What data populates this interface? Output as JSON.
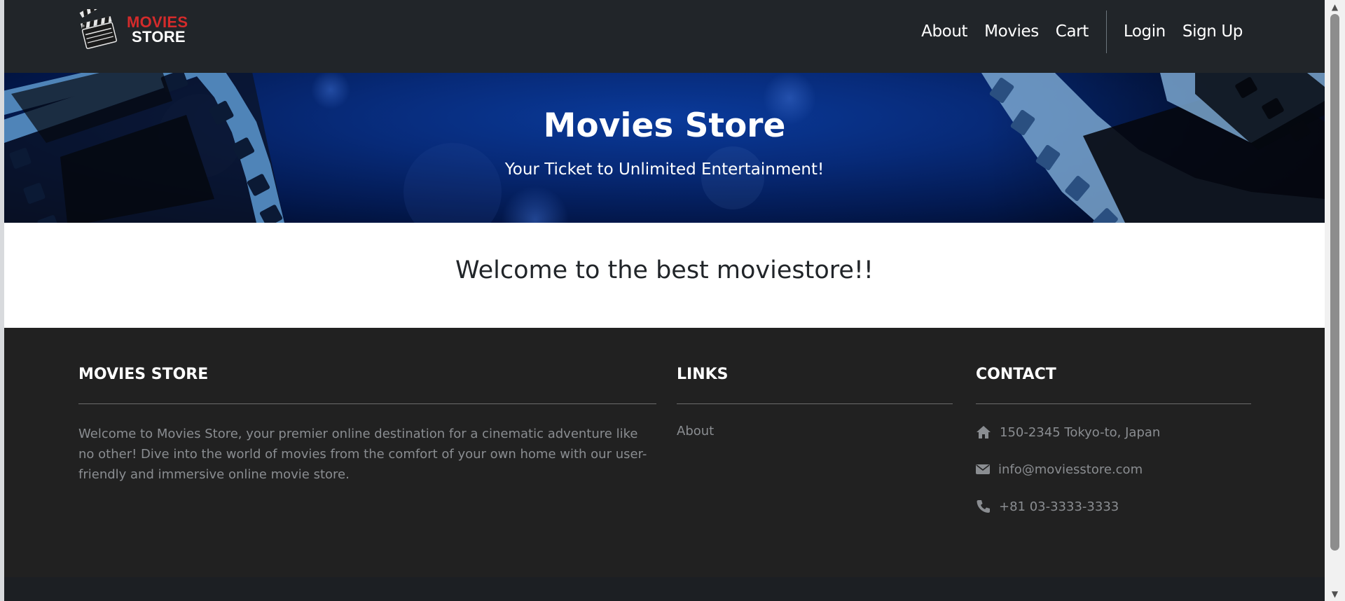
{
  "brand": {
    "logo_line1": "MOVIES",
    "logo_line2": "STORE",
    "logo_red": "#d42b2b"
  },
  "nav": {
    "about": "About",
    "movies": "Movies",
    "cart": "Cart",
    "login": "Login",
    "signup": "Sign Up"
  },
  "hero": {
    "title": "Movies Store",
    "subtitle": "Your Ticket to Unlimited Entertainment!",
    "background_color": "#072a78"
  },
  "welcome": {
    "heading": "Welcome to the best moviestore!!"
  },
  "footer": {
    "about": {
      "heading": "MOVIES STORE",
      "text": "Welcome to Movies Store, your premier online destination for a cinematic adventure like no other! Dive into the world of movies from the comfort of your own home with our user-friendly and immersive online movie store."
    },
    "links": {
      "heading": "LINKS",
      "items": [
        "About"
      ]
    },
    "contact": {
      "heading": "CONTACT",
      "address": "150-2345 Tokyo-to, Japan",
      "email": "info@moviesstore.com",
      "phone": "+81 03-3333-3333",
      "icons": [
        "home-icon",
        "envelope-icon",
        "phone-icon"
      ]
    }
  }
}
